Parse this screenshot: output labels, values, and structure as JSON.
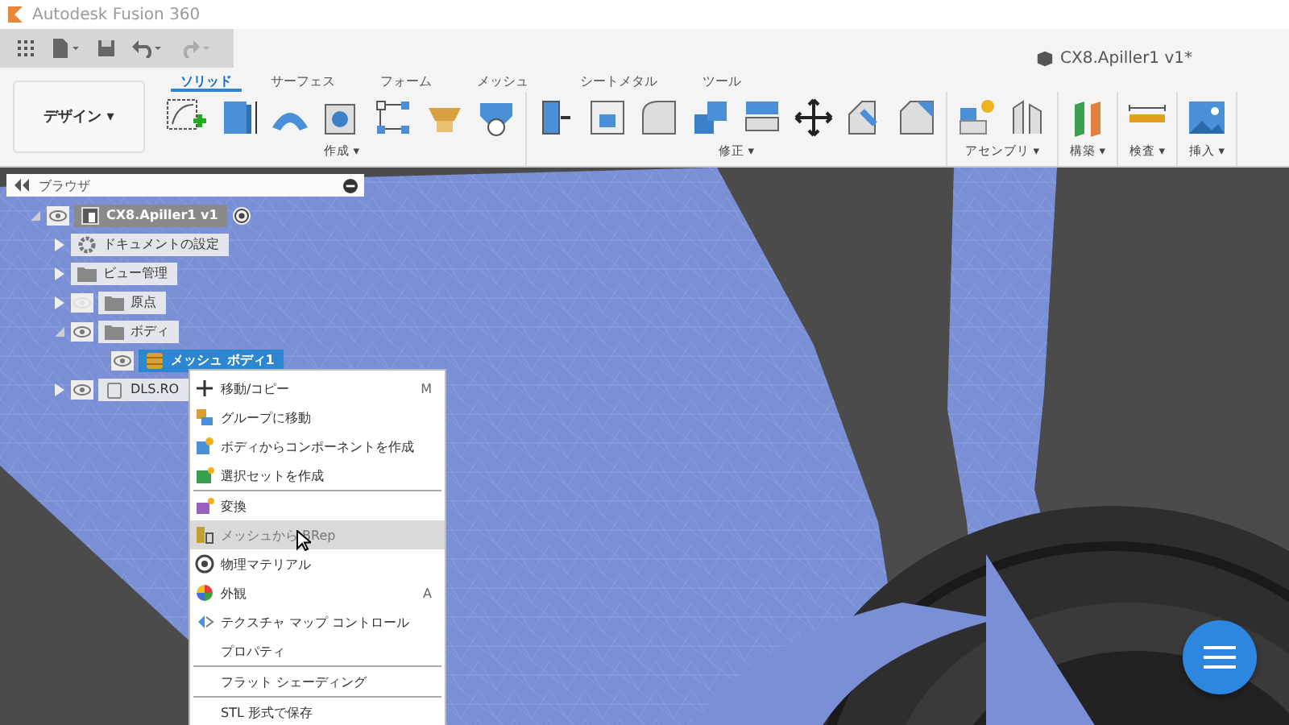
{
  "app": {
    "title": "Autodesk Fusion 360"
  },
  "document": {
    "title": "CX8.Apiller1 v1*"
  },
  "workspace": {
    "label": "デザイン ▾"
  },
  "tabs": [
    {
      "label": "ソリッド",
      "selected": true
    },
    {
      "label": "サーフェス",
      "selected": false
    },
    {
      "label": "フォーム",
      "selected": false
    },
    {
      "label": "メッシュ",
      "selected": false
    },
    {
      "label": "シートメタル",
      "selected": false
    },
    {
      "label": "ツール",
      "selected": false
    }
  ],
  "tool_groups": [
    {
      "label": "作成 ▾"
    },
    {
      "label": "修正 ▾"
    },
    {
      "label": "アセンブリ ▾"
    },
    {
      "label": "構築 ▾"
    },
    {
      "label": "検査 ▾"
    },
    {
      "label": "挿入 ▾"
    }
  ],
  "browser": {
    "title": "ブラウザ",
    "tree": [
      {
        "label": "CX8.Apiller1 v1",
        "kind": "component",
        "expanded": true,
        "visible": true,
        "selected": false,
        "children": [
          {
            "label": "ドキュメントの設定",
            "kind": "settings",
            "expanded": false,
            "selected": false
          },
          {
            "label": "ビュー管理",
            "kind": "folder",
            "expanded": false,
            "selected": false
          },
          {
            "label": "原点",
            "kind": "folder",
            "expanded": false,
            "visible": false,
            "selected": false
          },
          {
            "label": "ボディ",
            "kind": "folder",
            "expanded": true,
            "visible": true,
            "selected": false,
            "children": [
              {
                "label": "メッシュ ボディ1",
                "kind": "mesh",
                "visible": true,
                "selected": true
              }
            ]
          },
          {
            "label": "DLS.RO",
            "kind": "body",
            "expanded": false,
            "visible": true,
            "selected": false
          }
        ]
      }
    ]
  },
  "context_menu": {
    "items": [
      {
        "kind": "item",
        "label": "移動/コピー",
        "shortcut": "M",
        "selected": false
      },
      {
        "kind": "item",
        "label": "グループに移動",
        "selected": false
      },
      {
        "kind": "item",
        "label": "ボディからコンポーネントを作成",
        "selected": false
      },
      {
        "kind": "item",
        "label": "選択セットを作成",
        "selected": false
      },
      {
        "kind": "divider"
      },
      {
        "kind": "item",
        "label": "変換",
        "selected": false
      },
      {
        "kind": "item",
        "label": "メッシュから BRep",
        "selected": true
      },
      {
        "kind": "item",
        "label": "物理マテリアル",
        "selected": false
      },
      {
        "kind": "item",
        "label": "外観",
        "shortcut": "A",
        "selected": false
      },
      {
        "kind": "item",
        "label": "テクスチャ マップ コントロール",
        "selected": false
      },
      {
        "kind": "item",
        "label": "プロパティ",
        "selected": false
      },
      {
        "kind": "divider"
      },
      {
        "kind": "item",
        "label": "フラット シェーディング",
        "selected": false
      },
      {
        "kind": "divider"
      },
      {
        "kind": "item",
        "label": "STL 形式で保存",
        "selected": false
      }
    ]
  }
}
